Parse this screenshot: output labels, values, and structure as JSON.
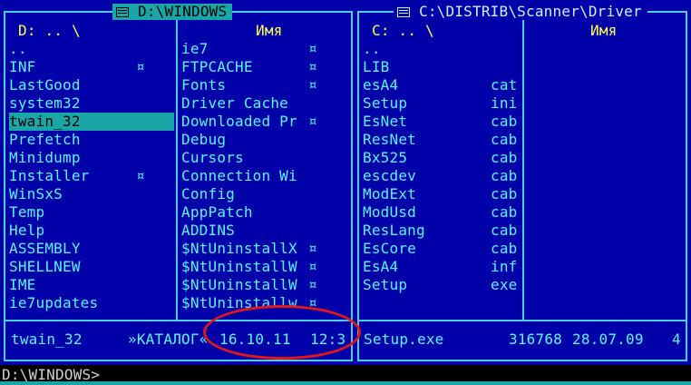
{
  "left_panel": {
    "title": "D:\\WINDOWS",
    "path_header": "D: .. \\",
    "name_header": "Имя",
    "col1": [
      {
        "name": "..",
        "mark": ""
      },
      {
        "name": "INF",
        "mark": "¤"
      },
      {
        "name": "LastGood",
        "mark": ""
      },
      {
        "name": "system32",
        "mark": ""
      },
      {
        "name": "twain_32",
        "mark": "",
        "selected": true
      },
      {
        "name": "Prefetch",
        "mark": ""
      },
      {
        "name": "Minidump",
        "mark": ""
      },
      {
        "name": "Installer",
        "mark": "¤"
      },
      {
        "name": "WinSxS",
        "mark": ""
      },
      {
        "name": "Temp",
        "mark": ""
      },
      {
        "name": "Help",
        "mark": ""
      },
      {
        "name": "ASSEMBLY",
        "mark": ""
      },
      {
        "name": "SHELLNEW",
        "mark": ""
      },
      {
        "name": "IME",
        "mark": ""
      },
      {
        "name": "ie7updates",
        "mark": ""
      }
    ],
    "col2": [
      {
        "name": "ie7",
        "mark": "¤"
      },
      {
        "name": "FTPCACHE",
        "mark": "¤"
      },
      {
        "name": "Fonts",
        "mark": "¤"
      },
      {
        "name": "Driver Cache",
        "mark": ""
      },
      {
        "name": "Downloaded Pr",
        "mark": "¤"
      },
      {
        "name": "Debug",
        "mark": ""
      },
      {
        "name": "Cursors",
        "mark": ""
      },
      {
        "name": "Connection Wi",
        "mark": ""
      },
      {
        "name": "Config",
        "mark": ""
      },
      {
        "name": "AppPatch",
        "mark": ""
      },
      {
        "name": "ADDINS",
        "mark": ""
      },
      {
        "name": "$NtUninstallX",
        "mark": "¤"
      },
      {
        "name": "$NtUninstallW",
        "mark": "¤"
      },
      {
        "name": "$NtUninstallW",
        "mark": "¤"
      },
      {
        "name": "$NtUninstallw",
        "mark": "¤"
      }
    ],
    "status": {
      "name": "twain_32",
      "type": "»КАТАЛОГ«",
      "date": "16.10.11",
      "time": "12:3"
    }
  },
  "right_panel": {
    "title": "C:\\DISTRIB\\Scanner\\Driver",
    "path_header": "C: .. \\",
    "name_header": "Имя",
    "files": [
      {
        "name": "..",
        "ext": ""
      },
      {
        "name": "LIB",
        "ext": ""
      },
      {
        "name": "esA4",
        "ext": "cat"
      },
      {
        "name": "Setup",
        "ext": "ini"
      },
      {
        "name": "EsNet",
        "ext": "cab"
      },
      {
        "name": "ResNet",
        "ext": "cab"
      },
      {
        "name": "Bx525",
        "ext": "cab"
      },
      {
        "name": "escdev",
        "ext": "cab"
      },
      {
        "name": "ModExt",
        "ext": "cab"
      },
      {
        "name": "ModUsd",
        "ext": "cab"
      },
      {
        "name": "ResLang",
        "ext": "cab"
      },
      {
        "name": "EsCore",
        "ext": "cab"
      },
      {
        "name": "EsA4",
        "ext": "inf"
      },
      {
        "name": "Setup",
        "ext": "exe"
      }
    ],
    "status": {
      "name": "Setup.exe",
      "size": "316768",
      "date": "28.07.09",
      "time": "4"
    }
  },
  "command_line": "D:\\WINDOWS>",
  "colors": {
    "background": "#0000a8",
    "frame": "#4ecbe0",
    "text": "#5cf5ff",
    "header": "#ffff55",
    "selection": "#1aa6a6",
    "annotation": "#e01818"
  }
}
